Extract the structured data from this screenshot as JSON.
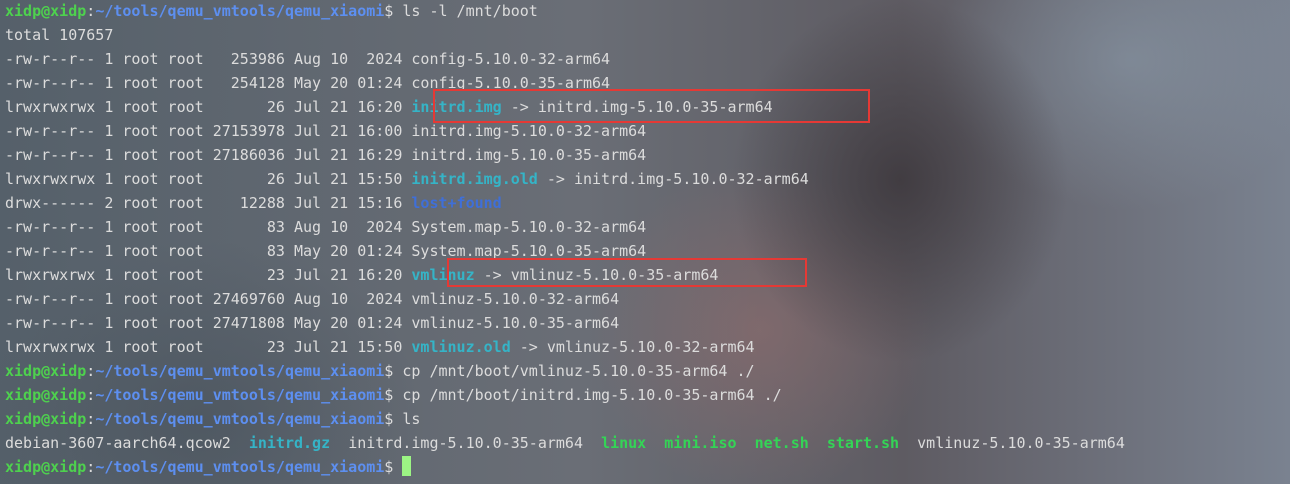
{
  "prompt": {
    "user": "xidp@xidp",
    "path": "~/tools/qemu_vmtools/qemu_xiaomi",
    "symbol": "$"
  },
  "commands": {
    "ls_boot": "ls -l /mnt/boot",
    "cp_vmlinuz": "cp /mnt/boot/vmlinuz-5.10.0-35-arm64 ./",
    "cp_initrd": "cp /mnt/boot/initrd.img-5.10.0-35-arm64 ./",
    "ls": "ls"
  },
  "listing": {
    "total": "total 107657",
    "rows": [
      {
        "meta": "-rw-r--r-- 1 root root   253986 Aug 10  2024 ",
        "name": "config-5.10.0-32-arm64",
        "type": "file",
        "arrow": "",
        "target": ""
      },
      {
        "meta": "-rw-r--r-- 1 root root   254128 May 20 01:24 ",
        "name": "config-5.10.0-35-arm64",
        "type": "file",
        "arrow": "",
        "target": ""
      },
      {
        "meta": "lrwxrwxrwx 1 root root       26 Jul 21 16:20 ",
        "name": "initrd.img",
        "type": "link",
        "arrow": " -> ",
        "target": "initrd.img-5.10.0-35-arm64"
      },
      {
        "meta": "-rw-r--r-- 1 root root 27153978 Jul 21 16:00 ",
        "name": "initrd.img-5.10.0-32-arm64",
        "type": "file",
        "arrow": "",
        "target": ""
      },
      {
        "meta": "-rw-r--r-- 1 root root 27186036 Jul 21 16:29 ",
        "name": "initrd.img-5.10.0-35-arm64",
        "type": "file",
        "arrow": "",
        "target": ""
      },
      {
        "meta": "lrwxrwxrwx 1 root root       26 Jul 21 15:50 ",
        "name": "initrd.img.old",
        "type": "link",
        "arrow": " -> ",
        "target": "initrd.img-5.10.0-32-arm64"
      },
      {
        "meta": "drwx------ 2 root root    12288 Jul 21 15:16 ",
        "name": "lost+found",
        "type": "dir",
        "arrow": "",
        "target": ""
      },
      {
        "meta": "-rw-r--r-- 1 root root       83 Aug 10  2024 ",
        "name": "System.map-5.10.0-32-arm64",
        "type": "file",
        "arrow": "",
        "target": ""
      },
      {
        "meta": "-rw-r--r-- 1 root root       83 May 20 01:24 ",
        "name": "System.map-5.10.0-35-arm64",
        "type": "file",
        "arrow": "",
        "target": ""
      },
      {
        "meta": "lrwxrwxrwx 1 root root       23 Jul 21 16:20 ",
        "name": "vmlinuz",
        "type": "link",
        "arrow": " -> ",
        "target": "vmlinuz-5.10.0-35-arm64"
      },
      {
        "meta": "-rw-r--r-- 1 root root 27469760 Aug 10  2024 ",
        "name": "vmlinuz-5.10.0-32-arm64",
        "type": "file",
        "arrow": "",
        "target": ""
      },
      {
        "meta": "-rw-r--r-- 1 root root 27471808 May 20 01:24 ",
        "name": "vmlinuz-5.10.0-35-arm64",
        "type": "file",
        "arrow": "",
        "target": ""
      },
      {
        "meta": "lrwxrwxrwx 1 root root       23 Jul 21 15:50 ",
        "name": "vmlinuz.old",
        "type": "link",
        "arrow": " -> ",
        "target": "vmlinuz-5.10.0-32-arm64"
      }
    ]
  },
  "ls_output": [
    {
      "name": "debian-3607-aarch64.qcow2",
      "type": "file"
    },
    {
      "name": "initrd.gz",
      "type": "link"
    },
    {
      "name": "initrd.img-5.10.0-35-arm64",
      "type": "file"
    },
    {
      "name": "linux",
      "type": "exe"
    },
    {
      "name": "mini.iso",
      "type": "exe"
    },
    {
      "name": "net.sh",
      "type": "exe"
    },
    {
      "name": "start.sh",
      "type": "exe"
    },
    {
      "name": "vmlinuz-5.10.0-35-arm64",
      "type": "file"
    }
  ],
  "colors": {
    "prompt_user": "#4ed14e",
    "prompt_path": "#5d8ff0",
    "symlink": "#35b4c7",
    "directory": "#3f6fd8",
    "executable": "#34d456",
    "highlight_box": "#e53935",
    "cursor": "#9cf584"
  }
}
